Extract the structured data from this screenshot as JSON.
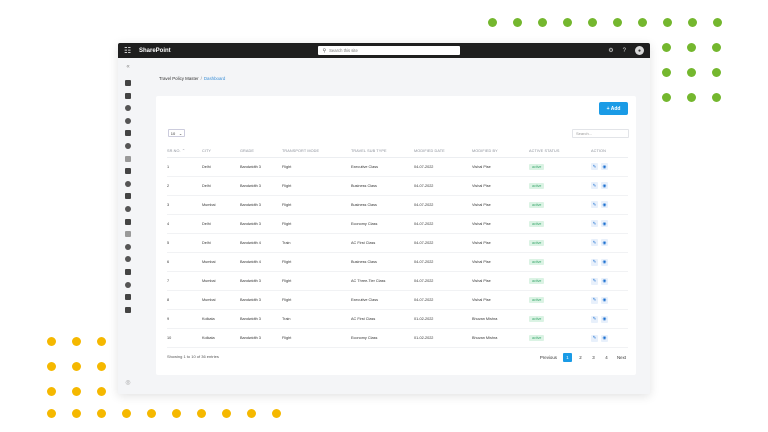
{
  "colors": {
    "accent": "#1a9be6",
    "dots_green": "#74b72e",
    "dots_yellow": "#f5b800",
    "active_badge_bg": "#dbf3e4",
    "active_badge_text": "#3aa76d"
  },
  "topbar": {
    "app_name": "SharePoint",
    "search_placeholder": "Search this site",
    "waffle_icon": "waffle-icon",
    "settings_icon": "gear-icon",
    "help_icon": "help-icon",
    "help_label": "?",
    "settings_label": "⚙"
  },
  "sidebar": {
    "collapse_label": "«",
    "bottom_label": "◎"
  },
  "breadcrumb": {
    "root": "Travel Policy Master",
    "separator": "/",
    "current": "Dashboard"
  },
  "toolbar": {
    "add_label": "+ Add",
    "page_length": "10",
    "search_placeholder": "Search..."
  },
  "table": {
    "headers": [
      "SR.NO.",
      "CITY",
      "GRADE",
      "TRANSPORT MODE",
      "TRAVEL SUB TYPE",
      "MODIFIED DATE",
      "MODIFIED BY",
      "ACTIVE STATUS",
      "ACTION"
    ],
    "sort_indicator": "⌃",
    "rows": [
      [
        "1",
        "Delhi",
        "Bandwidth 3",
        "Flight",
        "Executive Class",
        "04-07-2022",
        "Vishal Pise",
        "active"
      ],
      [
        "2",
        "Delhi",
        "Bandwidth 3",
        "Flight",
        "Business Class",
        "04-07-2022",
        "Vishal Pise",
        "active"
      ],
      [
        "3",
        "Mumbai",
        "Bandwidth 3",
        "Flight",
        "Business Class",
        "04-07-2022",
        "Vishal Pise",
        "active"
      ],
      [
        "4",
        "Delhi",
        "Bandwidth 3",
        "Flight",
        "Economy Class",
        "04-07-2022",
        "Vishal Pise",
        "active"
      ],
      [
        "5",
        "Delhi",
        "Bandwidth 4",
        "Train",
        "AC First Class",
        "04-07-2022",
        "Vishal Pise",
        "active"
      ],
      [
        "6",
        "Mumbai",
        "Bandwidth 4",
        "Flight",
        "Business Class",
        "04-07-2022",
        "Vishal Pise",
        "active"
      ],
      [
        "7",
        "Mumbai",
        "Bandwidth 3",
        "Flight",
        "AC Three-Tier Class",
        "04-07-2022",
        "Vishal Pise",
        "active"
      ],
      [
        "8",
        "Mumbai",
        "Bandwidth 3",
        "Flight",
        "Executive Class",
        "04-07-2022",
        "Vishal Pise",
        "active"
      ],
      [
        "9",
        "Kolkata",
        "Bandwidth 3",
        "Train",
        "AC First Class",
        "01-02-2022",
        "Bhuvan Mishra",
        "active"
      ],
      [
        "10",
        "Kolkata",
        "Bandwidth 3",
        "Flight",
        "Economy Class",
        "01-02-2022",
        "Bhuvan Mishra",
        "active"
      ]
    ]
  },
  "footer": {
    "info": "Showing 1 to 10 of 36 entries",
    "previous": "Previous",
    "pages": [
      "1",
      "2",
      "3",
      "4"
    ],
    "current_page": "1",
    "next": "Next"
  }
}
